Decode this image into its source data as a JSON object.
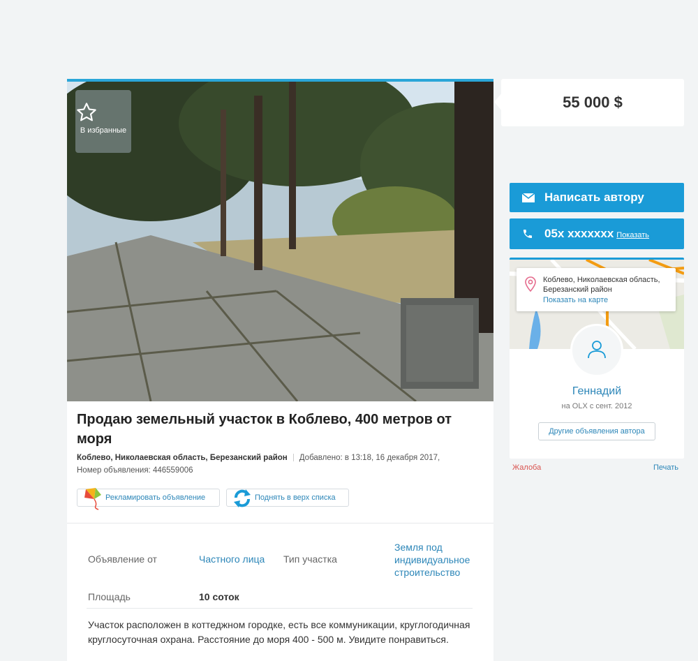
{
  "ad": {
    "favorite_label": "В избранные",
    "title": "Продаю земельный участок в Коблево, 400 метров от моря",
    "location": "Коблево, Николаевская область, Березанский район",
    "added": "Добавлено: в 13:18, 16 декабря 2017,",
    "ad_number": "Номер объявления: 446559006",
    "promote_label": "Рекламировать объявление",
    "raise_label": "Поднять в верх списка"
  },
  "params": {
    "offer_from_label": "Объявление от",
    "offer_from_value": "Частного лица",
    "plot_type_label": "Тип участка",
    "plot_type_value": "Земля под индивидуальное строительство",
    "area_label": "Площадь",
    "area_value": "10 соток"
  },
  "description": "Участок расположен в коттеджном городке, есть все коммуникации, круглогодичная круглосуточная охрана. Расстояние до моря 400 - 500 м. Увидите понравиться.",
  "sidebar": {
    "price": "55 000 $",
    "write_author": "Написать автору",
    "phone": "05x xxxxxxx",
    "show_phone": "Показать",
    "map_address": "Коблево, Николаевская область, Березанский район",
    "show_on_map": "Показать на карте",
    "user_name": "Геннадий",
    "user_since": "на OLX с сент. 2012",
    "other_ads": "Другие объявления автора",
    "complaint": "Жалоба",
    "print": "Печать"
  },
  "colors": {
    "accent": "#1a9bd7",
    "link": "#2c86b8",
    "complaint": "#d9534f"
  },
  "icons": {
    "favorite": "star-icon",
    "promote": "kite-icon",
    "raise": "refresh-icon",
    "mail": "envelope-icon",
    "phone": "phone-icon",
    "map": "map-pin-icon",
    "user": "user-icon"
  }
}
